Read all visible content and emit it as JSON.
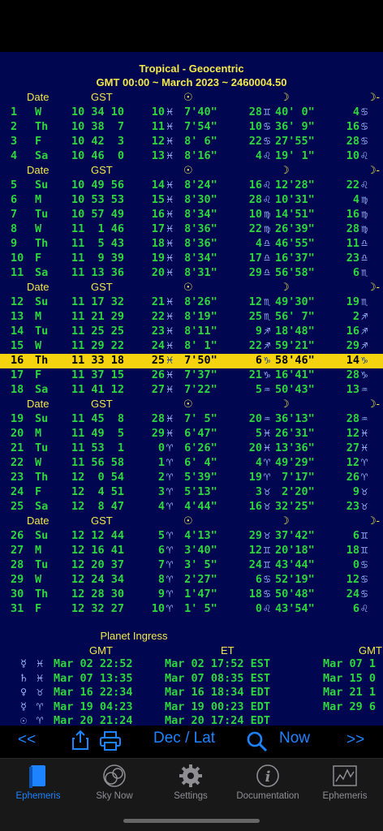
{
  "header": {
    "line1": "Tropical - Geocentric",
    "line2": "GMT 00:00 ~ March 2023 ~ 2460004.50"
  },
  "column_headers": {
    "date": "Date",
    "gst": "GST",
    "sun": "☉",
    "moon": "☽",
    "node": "☽-"
  },
  "weeks": [
    [
      {
        "d": "1",
        "w": "W",
        "gst": "10 34 10",
        "sd": "10",
        "ss": "♓",
        "sm": " 7'40\"",
        "md": "28",
        "ms": "♊",
        "mm": "40' 0\"",
        "nd": "4",
        "ns": "♋"
      },
      {
        "d": "2",
        "w": "Th",
        "gst": "10 38  7",
        "sd": "11",
        "ss": "♓",
        "sm": " 7'54\"",
        "md": "10",
        "ms": "♋",
        "mm": "36' 9\"",
        "nd": "16",
        "ns": "♋"
      },
      {
        "d": "3",
        "w": "F",
        "gst": "10 42  3",
        "sd": "12",
        "ss": "♓",
        "sm": " 8' 6\"",
        "md": "22",
        "ms": "♋",
        "mm": "27'55\"",
        "nd": "28",
        "ns": "♋"
      },
      {
        "d": "4",
        "w": "Sa",
        "gst": "10 46  0",
        "sd": "13",
        "ss": "♓",
        "sm": " 8'16\"",
        "md": "4",
        "ms": "♌",
        "mm": "19' 1\"",
        "nd": "10",
        "ns": "♌"
      }
    ],
    [
      {
        "d": "5",
        "w": "Su",
        "gst": "10 49 56",
        "sd": "14",
        "ss": "♓",
        "sm": " 8'24\"",
        "md": "16",
        "ms": "♌",
        "mm": "12'28\"",
        "nd": "22",
        "ns": "♌"
      },
      {
        "d": "6",
        "w": "M",
        "gst": "10 53 53",
        "sd": "15",
        "ss": "♓",
        "sm": " 8'30\"",
        "md": "28",
        "ms": "♌",
        "mm": "10'31\"",
        "nd": "4",
        "ns": "♍"
      },
      {
        "d": "7",
        "w": "Tu",
        "gst": "10 57 49",
        "sd": "16",
        "ss": "♓",
        "sm": " 8'34\"",
        "md": "10",
        "ms": "♍",
        "mm": "14'51\"",
        "nd": "16",
        "ns": "♍"
      },
      {
        "d": "8",
        "w": "W",
        "gst": "11  1 46",
        "sd": "17",
        "ss": "♓",
        "sm": " 8'36\"",
        "md": "22",
        "ms": "♍",
        "mm": "26'39\"",
        "nd": "28",
        "ns": "♍"
      },
      {
        "d": "9",
        "w": "Th",
        "gst": "11  5 43",
        "sd": "18",
        "ss": "♓",
        "sm": " 8'36\"",
        "md": "4",
        "ms": "♎",
        "mm": "46'55\"",
        "nd": "11",
        "ns": "♎"
      },
      {
        "d": "10",
        "w": "F",
        "gst": "11  9 39",
        "sd": "19",
        "ss": "♓",
        "sm": " 8'34\"",
        "md": "17",
        "ms": "♎",
        "mm": "16'37\"",
        "nd": "23",
        "ns": "♎"
      },
      {
        "d": "11",
        "w": "Sa",
        "gst": "11 13 36",
        "sd": "20",
        "ss": "♓",
        "sm": " 8'31\"",
        "md": "29",
        "ms": "♎",
        "mm": "56'58\"",
        "nd": "6",
        "ns": "♏"
      }
    ],
    [
      {
        "d": "12",
        "w": "Su",
        "gst": "11 17 32",
        "sd": "21",
        "ss": "♓",
        "sm": " 8'26\"",
        "md": "12",
        "ms": "♏",
        "mm": "49'30\"",
        "nd": "19",
        "ns": "♏"
      },
      {
        "d": "13",
        "w": "M",
        "gst": "11 21 29",
        "sd": "22",
        "ss": "♓",
        "sm": " 8'19\"",
        "md": "25",
        "ms": "♏",
        "mm": "56' 7\"",
        "nd": "2",
        "ns": "♐"
      },
      {
        "d": "14",
        "w": "Tu",
        "gst": "11 25 25",
        "sd": "23",
        "ss": "♓",
        "sm": " 8'11\"",
        "md": "9",
        "ms": "♐",
        "mm": "18'48\"",
        "nd": "16",
        "ns": "♐"
      },
      {
        "d": "15",
        "w": "W",
        "gst": "11 29 22",
        "sd": "24",
        "ss": "♓",
        "sm": " 8' 1\"",
        "md": "22",
        "ms": "♐",
        "mm": "59'21\"",
        "nd": "29",
        "ns": "♐"
      },
      {
        "d": "16",
        "w": "Th",
        "gst": "11 33 18",
        "sd": "25",
        "ss": "♓",
        "sm": " 7'50\"",
        "md": "6",
        "ms": "♑",
        "mm": "58'46\"",
        "nd": "14",
        "ns": "♑",
        "hl": true
      },
      {
        "d": "17",
        "w": "F",
        "gst": "11 37 15",
        "sd": "26",
        "ss": "♓",
        "sm": " 7'37\"",
        "md": "21",
        "ms": "♑",
        "mm": "16'41\"",
        "nd": "28",
        "ns": "♑"
      },
      {
        "d": "18",
        "w": "Sa",
        "gst": "11 41 12",
        "sd": "27",
        "ss": "♓",
        "sm": " 7'22\"",
        "md": "5",
        "ms": "♒",
        "mm": "50'43\"",
        "nd": "13",
        "ns": "♒"
      }
    ],
    [
      {
        "d": "19",
        "w": "Su",
        "gst": "11 45  8",
        "sd": "28",
        "ss": "♓",
        "sm": " 7' 5\"",
        "md": "20",
        "ms": "♒",
        "mm": "36'13\"",
        "nd": "28",
        "ns": "♒"
      },
      {
        "d": "20",
        "w": "M",
        "gst": "11 49  5",
        "sd": "29",
        "ss": "♓",
        "sm": " 6'47\"",
        "md": "5",
        "ms": "♓",
        "mm": "26'31\"",
        "nd": "12",
        "ns": "♓"
      },
      {
        "d": "21",
        "w": "Tu",
        "gst": "11 53  1",
        "sd": "0",
        "ss": "♈",
        "sm": " 6'26\"",
        "md": "20",
        "ms": "♓",
        "mm": "13'36\"",
        "nd": "27",
        "ns": "♓"
      },
      {
        "d": "22",
        "w": "W",
        "gst": "11 56 58",
        "sd": "1",
        "ss": "♈",
        "sm": " 6' 4\"",
        "md": "4",
        "ms": "♈",
        "mm": "49'29\"",
        "nd": "12",
        "ns": "♈"
      },
      {
        "d": "23",
        "w": "Th",
        "gst": "12  0 54",
        "sd": "2",
        "ss": "♈",
        "sm": " 5'39\"",
        "md": "19",
        "ms": "♈",
        "mm": " 7'17\"",
        "nd": "26",
        "ns": "♈"
      },
      {
        "d": "24",
        "w": "F",
        "gst": "12  4 51",
        "sd": "3",
        "ss": "♈",
        "sm": " 5'13\"",
        "md": "3",
        "ms": "♉",
        "mm": " 2'20\"",
        "nd": "9",
        "ns": "♉"
      },
      {
        "d": "25",
        "w": "Sa",
        "gst": "12  8 47",
        "sd": "4",
        "ss": "♈",
        "sm": " 4'44\"",
        "md": "16",
        "ms": "♉",
        "mm": "32'25\"",
        "nd": "23",
        "ns": "♉"
      }
    ],
    [
      {
        "d": "26",
        "w": "Su",
        "gst": "12 12 44",
        "sd": "5",
        "ss": "♈",
        "sm": " 4'13\"",
        "md": "29",
        "ms": "♉",
        "mm": "37'42\"",
        "nd": "6",
        "ns": "♊"
      },
      {
        "d": "27",
        "w": "M",
        "gst": "12 16 41",
        "sd": "6",
        "ss": "♈",
        "sm": " 3'40\"",
        "md": "12",
        "ms": "♊",
        "mm": "20'18\"",
        "nd": "18",
        "ns": "♊"
      },
      {
        "d": "28",
        "w": "Tu",
        "gst": "12 20 37",
        "sd": "7",
        "ss": "♈",
        "sm": " 3' 5\"",
        "md": "24",
        "ms": "♊",
        "mm": "43'44\"",
        "nd": "0",
        "ns": "♋"
      },
      {
        "d": "29",
        "w": "W",
        "gst": "12 24 34",
        "sd": "8",
        "ss": "♈",
        "sm": " 2'27\"",
        "md": "6",
        "ms": "♋",
        "mm": "52'19\"",
        "nd": "12",
        "ns": "♋"
      },
      {
        "d": "30",
        "w": "Th",
        "gst": "12 28 30",
        "sd": "9",
        "ss": "♈",
        "sm": " 1'47\"",
        "md": "18",
        "ms": "♋",
        "mm": "50'48\"",
        "nd": "24",
        "ns": "♋"
      },
      {
        "d": "31",
        "w": "F",
        "gst": "12 32 27",
        "sd": "10",
        "ss": "♈",
        "sm": " 1' 5\"",
        "md": "0",
        "ms": "♌",
        "mm": "43'54\"",
        "nd": "6",
        "ns": "♌"
      }
    ]
  ],
  "ingress": {
    "title": "Planet Ingress",
    "col_gmt": "GMT",
    "col_et": "ET",
    "col_gmt2": "GMT",
    "rows": [
      {
        "planet": "☿",
        "sign": "♓",
        "gmt": "Mar 02 22:52",
        "et": "Mar 02 17:52 EST",
        "gmt2": "Mar 07 1"
      },
      {
        "planet": "♄",
        "sign": "♓",
        "gmt": "Mar 07 13:35",
        "et": "Mar 07 08:35 EST",
        "gmt2": "Mar 15 0"
      },
      {
        "planet": "♀",
        "sign": "♉",
        "gmt": "Mar 16 22:34",
        "et": "Mar 16 18:34 EDT",
        "gmt2": "Mar 21 1"
      },
      {
        "planet": "☿",
        "sign": "♈",
        "gmt": "Mar 19 04:23",
        "et": "Mar 19 00:23 EDT",
        "gmt2": "Mar 29 6"
      },
      {
        "planet": "☉",
        "sign": "♈",
        "gmt": "Mar 20 21:24",
        "et": "Mar 20 17:24 EDT",
        "gmt2": ""
      }
    ]
  },
  "toolbar": {
    "prev": "<<",
    "mode": "Dec / Lat",
    "now": "Now",
    "next": ">>"
  },
  "tabs": [
    {
      "label": "Ephemeris",
      "icon": "book-icon",
      "active": true
    },
    {
      "label": "Sky Now",
      "icon": "sky-icon",
      "active": false
    },
    {
      "label": "Settings",
      "icon": "gear-icon",
      "active": false
    },
    {
      "label": "Documentation",
      "icon": "info-icon",
      "active": false
    },
    {
      "label": "Ephemeris",
      "icon": "chart-icon",
      "active": false
    }
  ],
  "colors": {
    "background": "#00064f",
    "text": "#2fd63e",
    "header": "#f4e84a",
    "highlight": "#f5d40f",
    "accent": "#1e83ff"
  }
}
